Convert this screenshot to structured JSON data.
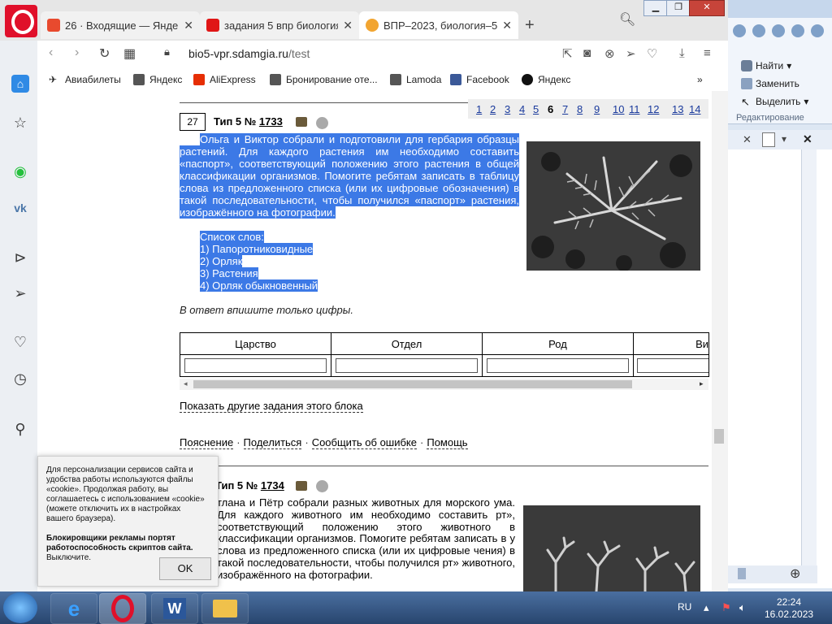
{
  "tabs": [
    {
      "label": "26 · Входящие — Яндекс П",
      "favicon_color": "#e84a2e"
    },
    {
      "label": "задания 5 впр биология 5",
      "favicon_color": "#e01616"
    },
    {
      "label": "ВПР–2023, биология–5: за",
      "favicon_color": "#f2a531"
    }
  ],
  "address": {
    "host": "bio5-vpr.sdamgia.ru",
    "path": "/test"
  },
  "bookmarks": [
    "Авиабилеты",
    "Яндекс",
    "AliExpress",
    "Бронирование оте...",
    "Lamoda",
    "Facebook",
    "Яндекс"
  ],
  "word": {
    "find": "Найти",
    "replace": "Заменить",
    "select": "Выделить",
    "group": "Редактирование"
  },
  "task_numbers": [
    "1",
    "2",
    "3",
    "4",
    "5",
    "6",
    "7",
    "8",
    "9",
    "10",
    "11",
    "12",
    "13",
    "14"
  ],
  "current_task_number": "6",
  "task1": {
    "index": "27",
    "type_label": "Тип 5 №",
    "id": "1733",
    "text": "Ольга и Виктор собрали и подготовили для гербария образцы растений. Для каждого растения им необходимо составить «паспорт», соответствующий положению этого растения в общей классификации организмов. Помогите ребятам записать в таблицу слова из предложенного списка (или их цифровые обозначения) в такой последовательности, чтобы получился «паспорт» растения, изображённого на фотографии.",
    "list_title": "Список слов:",
    "list": [
      "1) Папоротниковидные",
      "2) Орляк",
      "3) Растения",
      "4) Орляк обыкновенный"
    ],
    "answer_note": "В ответ впишите только цифры.",
    "table_headers": [
      "Царство",
      "Отдел",
      "Род",
      "Ви"
    ]
  },
  "show_more": "Показать другие задания этого блока",
  "links": [
    "Пояснение",
    "Поделиться",
    "Сообщить об ошибке",
    "Помощь"
  ],
  "task2": {
    "type_label": "Тип 5 №",
    "id": "1734",
    "text": "тлана и Пётр собрали разных животных для морского ума. Для каждого животного им необходимо составить рт», соответствующий положению этого животного в классификации организмов. Помогите ребятам записать в у слова из предложенного списка (или их цифровые чения) в такой последовательности, чтобы получился рт» животного, изображённого на фотографии."
  },
  "cookie": {
    "text": "Для персонализации сервисов сайта и удобства работы используются файлы «cookie». Продолжая работу, вы соглашаетесь с использованием «cookie» (можете отключить их в настройках вашего браузера).",
    "bold": "Блокировщики рекламы портят работоспособность скриптов сайта.",
    "action": "Выключите.",
    "ok": "OK"
  },
  "taskbar": {
    "lang": "RU",
    "time": "22:24",
    "date": "16.02.2023"
  }
}
